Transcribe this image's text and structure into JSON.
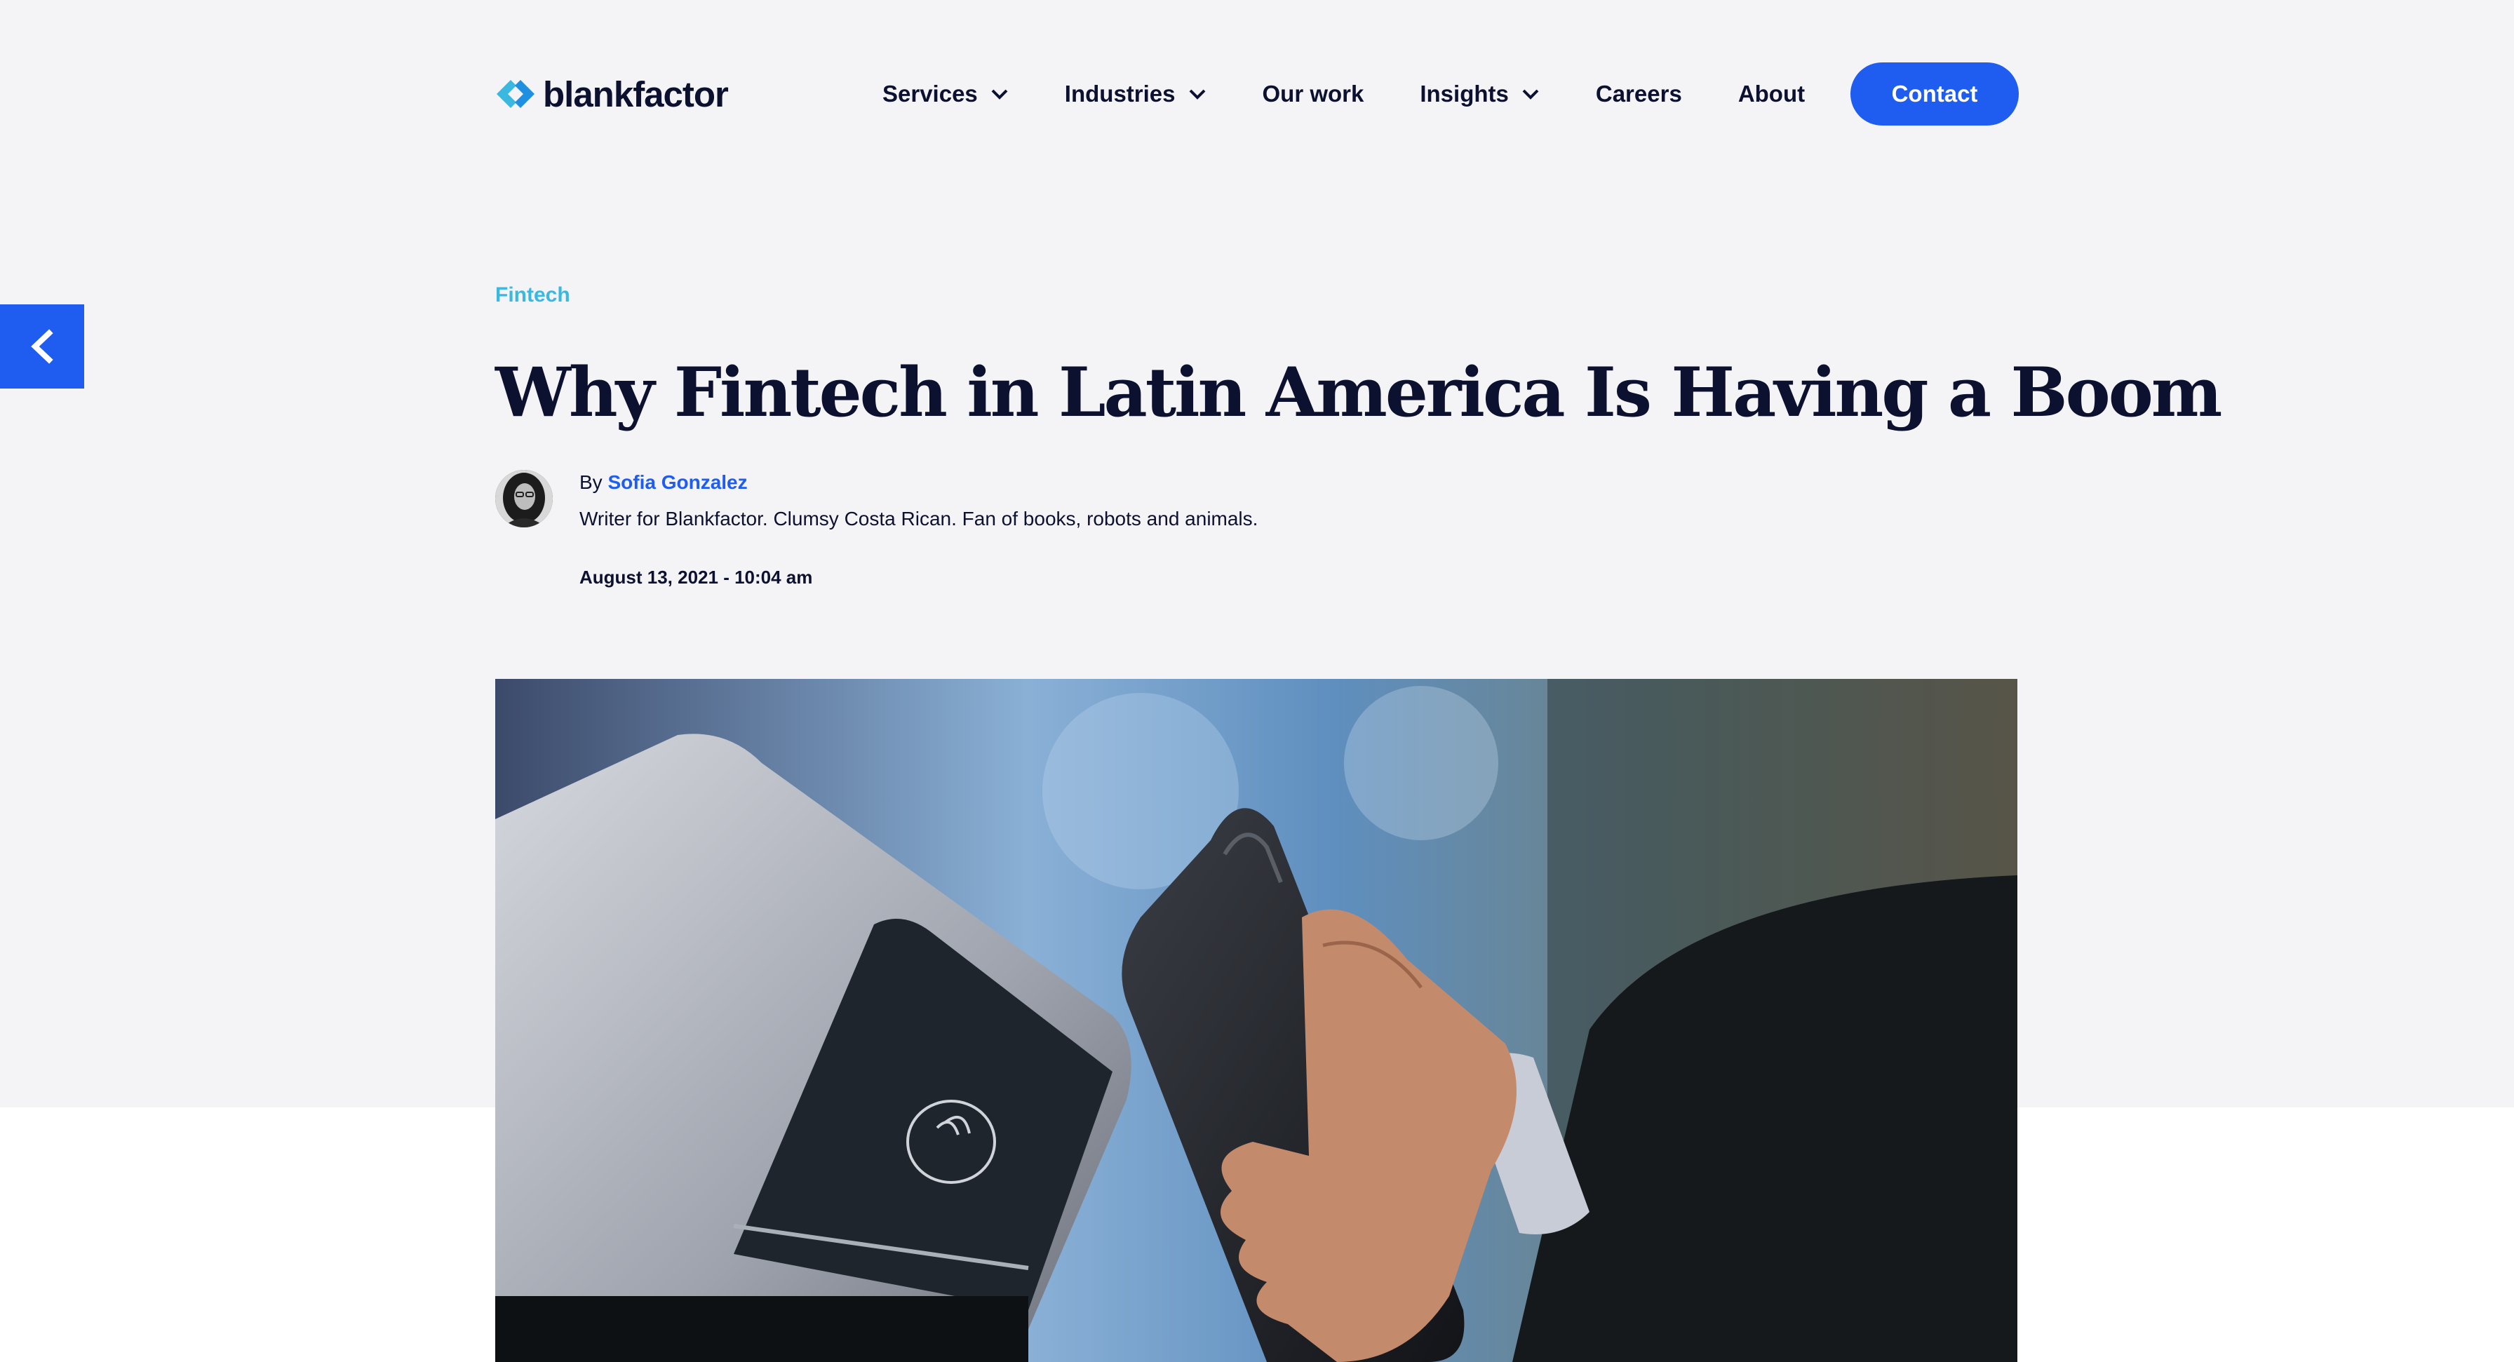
{
  "header": {
    "logo_text": "blankfactor",
    "logo_icon": "chevron-brackets-icon",
    "nav": [
      {
        "label": "Services",
        "has_dropdown": true
      },
      {
        "label": "Industries",
        "has_dropdown": true
      },
      {
        "label": "Our work",
        "has_dropdown": false
      },
      {
        "label": "Insights",
        "has_dropdown": true
      },
      {
        "label": "Careers",
        "has_dropdown": false
      },
      {
        "label": "About",
        "has_dropdown": false
      }
    ],
    "contact_label": "Contact"
  },
  "back_button": {
    "icon": "chevron-left-icon"
  },
  "article": {
    "category": "Fintech",
    "title": "Why Fintech in Latin America Is Having a Boom",
    "by_label": "By",
    "author": "Sofia Gonzalez",
    "bio": "Writer for Blankfactor. Clumsy Costa Rican. Fan of books, robots and animals.",
    "date": "August 13, 2021 - 10:04 am"
  },
  "colors": {
    "accent": "#1f5df0",
    "category": "#3ab8e0",
    "text": "#0d1130",
    "band": "#f4f4f7"
  }
}
